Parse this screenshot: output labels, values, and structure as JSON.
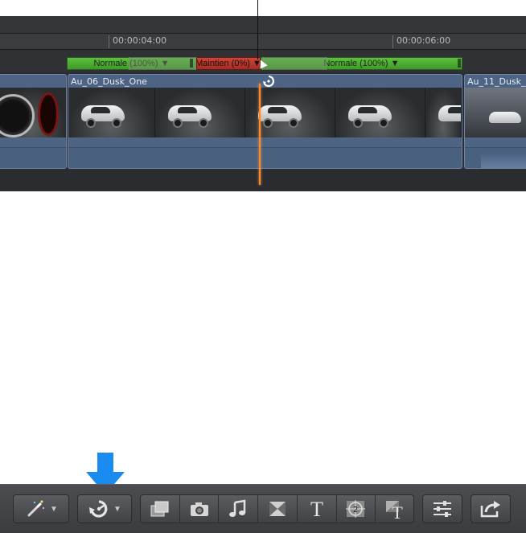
{
  "ruler": {
    "timecode_1": "00:00:04:00",
    "timecode_2": "00:00:06:00"
  },
  "retime": {
    "segment_1": "Normale (100%) ▼",
    "segment_2": "Maintien (0%) ▼",
    "segment_3": "Normale (100%) ▼",
    "colors": {
      "normal": "#4fa935",
      "hold": "#b83a30"
    }
  },
  "clips": {
    "clip_1_title": "",
    "clip_2_title": "Au_06_Dusk_One",
    "clip_3_title": "Au_11_Dusk_"
  },
  "playhead": {
    "color": "#ff8a2a"
  },
  "toolbar": {
    "groups": [
      {
        "name": "enhancements",
        "icons": [
          "magic-wand-icon"
        ]
      },
      {
        "name": "retime",
        "icons": [
          "retime-icon"
        ]
      },
      {
        "name": "browsers",
        "icons": [
          "media-browser-icon",
          "photo-browser-icon",
          "music-browser-icon",
          "transitions-browser-icon",
          "titles-browser-icon",
          "generators-browser-icon",
          "themes-browser-icon"
        ]
      },
      {
        "name": "inspector",
        "icons": [
          "inspector-icon"
        ]
      },
      {
        "name": "share",
        "icons": [
          "share-icon"
        ]
      }
    ],
    "highlight_color": "#1a8cf0"
  }
}
